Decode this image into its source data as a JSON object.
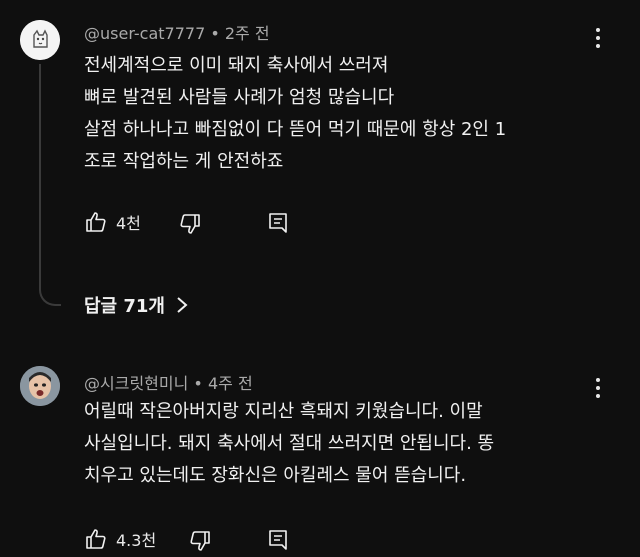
{
  "comments": [
    {
      "handle": "@user-cat7777",
      "separator": "•",
      "time": "2주 전",
      "lines": [
        "전세계적으로 이미 돼지 축사에서 쓰러져",
        "뼈로 발견된 사람들 사례가 엄청 많습니다",
        "살점 하나나고 빠짐없이 다 뜯어 먹기 때문에 항상 2인 1",
        "조로 작업하는 게 안전하죠"
      ],
      "likes": "4천",
      "replies_label": "답글 71개"
    },
    {
      "handle": "@시크릿현미니",
      "separator": "•",
      "time": "4주 전",
      "lines": [
        "어릴때 작은아버지랑 지리산 흑돼지 키웠습니다. 이말",
        "사실입니다. 돼지 축사에서 절대 쓰러지면 안됩니다. 똥",
        "치우고 있는데도 장화신은 아킬레스 물어 뜯습니다."
      ],
      "likes": "4.3천"
    }
  ]
}
